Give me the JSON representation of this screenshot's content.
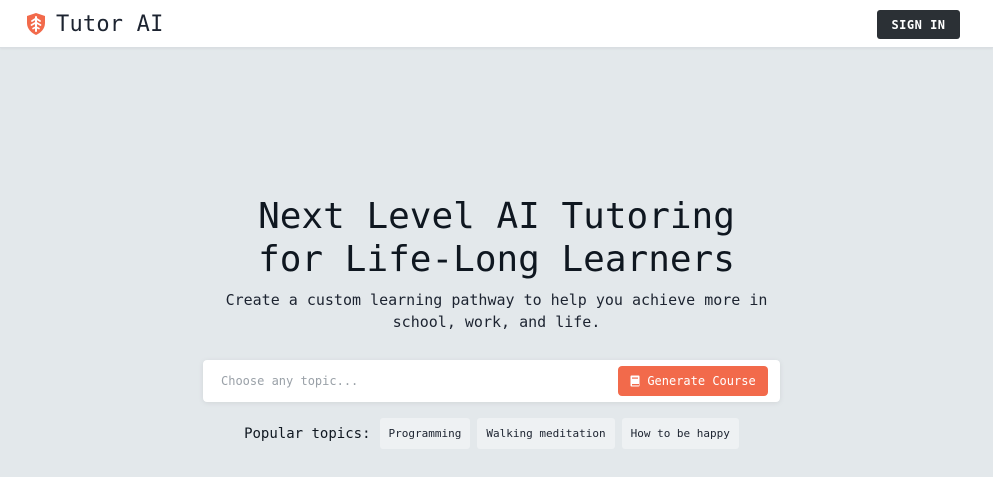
{
  "brand": {
    "name": "Tutor AI",
    "icon": "shield-tree-logo-icon",
    "color": "#f26a4b"
  },
  "header": {
    "signin_label": "SIGN IN"
  },
  "hero": {
    "title": "Next Level AI Tutoring\nfor Life-Long Learners",
    "subtitle": "Create a custom learning pathway to help you achieve more in school, work, and life."
  },
  "search": {
    "placeholder": "Choose any topic...",
    "value": "",
    "button_label": "Generate Course",
    "button_icon": "book-icon",
    "accent": "#f26a4b"
  },
  "popular": {
    "label": "Popular topics:",
    "topics": [
      "Programming",
      "Walking meditation",
      "How to be happy"
    ]
  }
}
